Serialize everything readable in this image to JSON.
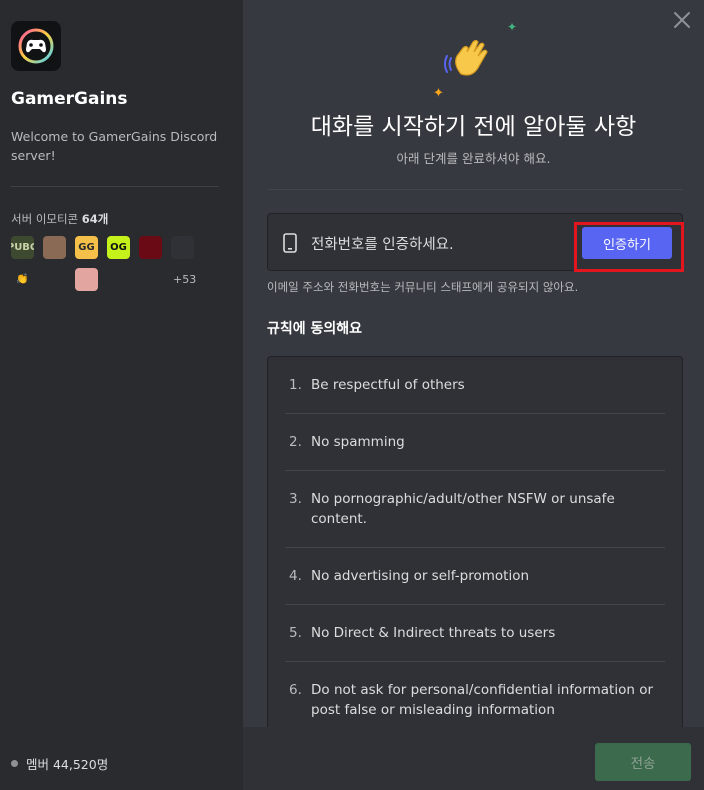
{
  "server": {
    "name": "GamerGains",
    "description": "Welcome to GamerGains Discord server!",
    "emoji_title_prefix": "서버 이모티콘",
    "emoji_count": "64개",
    "emojis": [
      {
        "icon": "pubg-emoji",
        "text": "PUBG",
        "bg": "#3d4a2f",
        "fg": "#c9d1a8"
      },
      {
        "icon": "face-photo-emoji",
        "text": "",
        "bg": "#8a6a55",
        "fg": "#ffffff"
      },
      {
        "icon": "gg-bag-emoji",
        "text": "GG",
        "bg": "#f4c04a",
        "fg": "#2a2a2a"
      },
      {
        "icon": "og-emoji",
        "text": "OG",
        "bg": "#c6f21b",
        "fg": "#111111"
      },
      {
        "icon": "red-orb-emoji",
        "text": "",
        "bg": "#6a0a14",
        "fg": "#ff3a3a"
      },
      {
        "icon": "person-emoji",
        "text": "",
        "bg": "#2f3136",
        "fg": "#dcddde"
      },
      {
        "icon": "clap-hands-emoji",
        "text": "👏",
        "bg": "transparent",
        "fg": "#f7c04a"
      },
      {
        "icon": "cheese-emoji",
        "text": "",
        "bg": "transparent",
        "fg": "#f4b400"
      },
      {
        "icon": "pink-face-emoji",
        "text": "",
        "bg": "#e3a5a0",
        "fg": "#ffffff"
      },
      {
        "icon": "pepe-emoji",
        "text": "",
        "bg": "transparent",
        "fg": "#5aa33f"
      },
      {
        "icon": "baby-face-emoji",
        "text": "",
        "bg": "transparent",
        "fg": "#e0b090"
      }
    ],
    "emoji_more": "+53",
    "members": "멤버 44,520명"
  },
  "onboarding": {
    "title": "대화를 시작하기 전에 알아둘 사항",
    "subtitle": "아래 단계를 완료하셔야 해요.",
    "verify_text": "전화번호를 인증하세요.",
    "verify_button": "인증하기",
    "verify_note": "이메일 주소와 전화번호는 커뮤니티 스태프에게 공유되지 않아요.",
    "rules_heading": "규칙에 동의해요",
    "rules": [
      {
        "num": "1.",
        "text": "Be respectful of others"
      },
      {
        "num": "2.",
        "text": "No spamming"
      },
      {
        "num": "3.",
        "text": "No pornographic/adult/other NSFW or unsafe content."
      },
      {
        "num": "4.",
        "text": "No advertising or self-promotion"
      },
      {
        "num": "5.",
        "text": "No Direct & Indirect threats to users"
      },
      {
        "num": "6.",
        "text": "Do not ask for personal/confidential information or post false or misleading information"
      },
      {
        "num": "",
        "text": ""
      }
    ],
    "submit_button": "전송"
  },
  "colors": {
    "accent": "#5865f2",
    "highlight": "#e3151e",
    "submit_disabled": "#3b6a4c"
  }
}
